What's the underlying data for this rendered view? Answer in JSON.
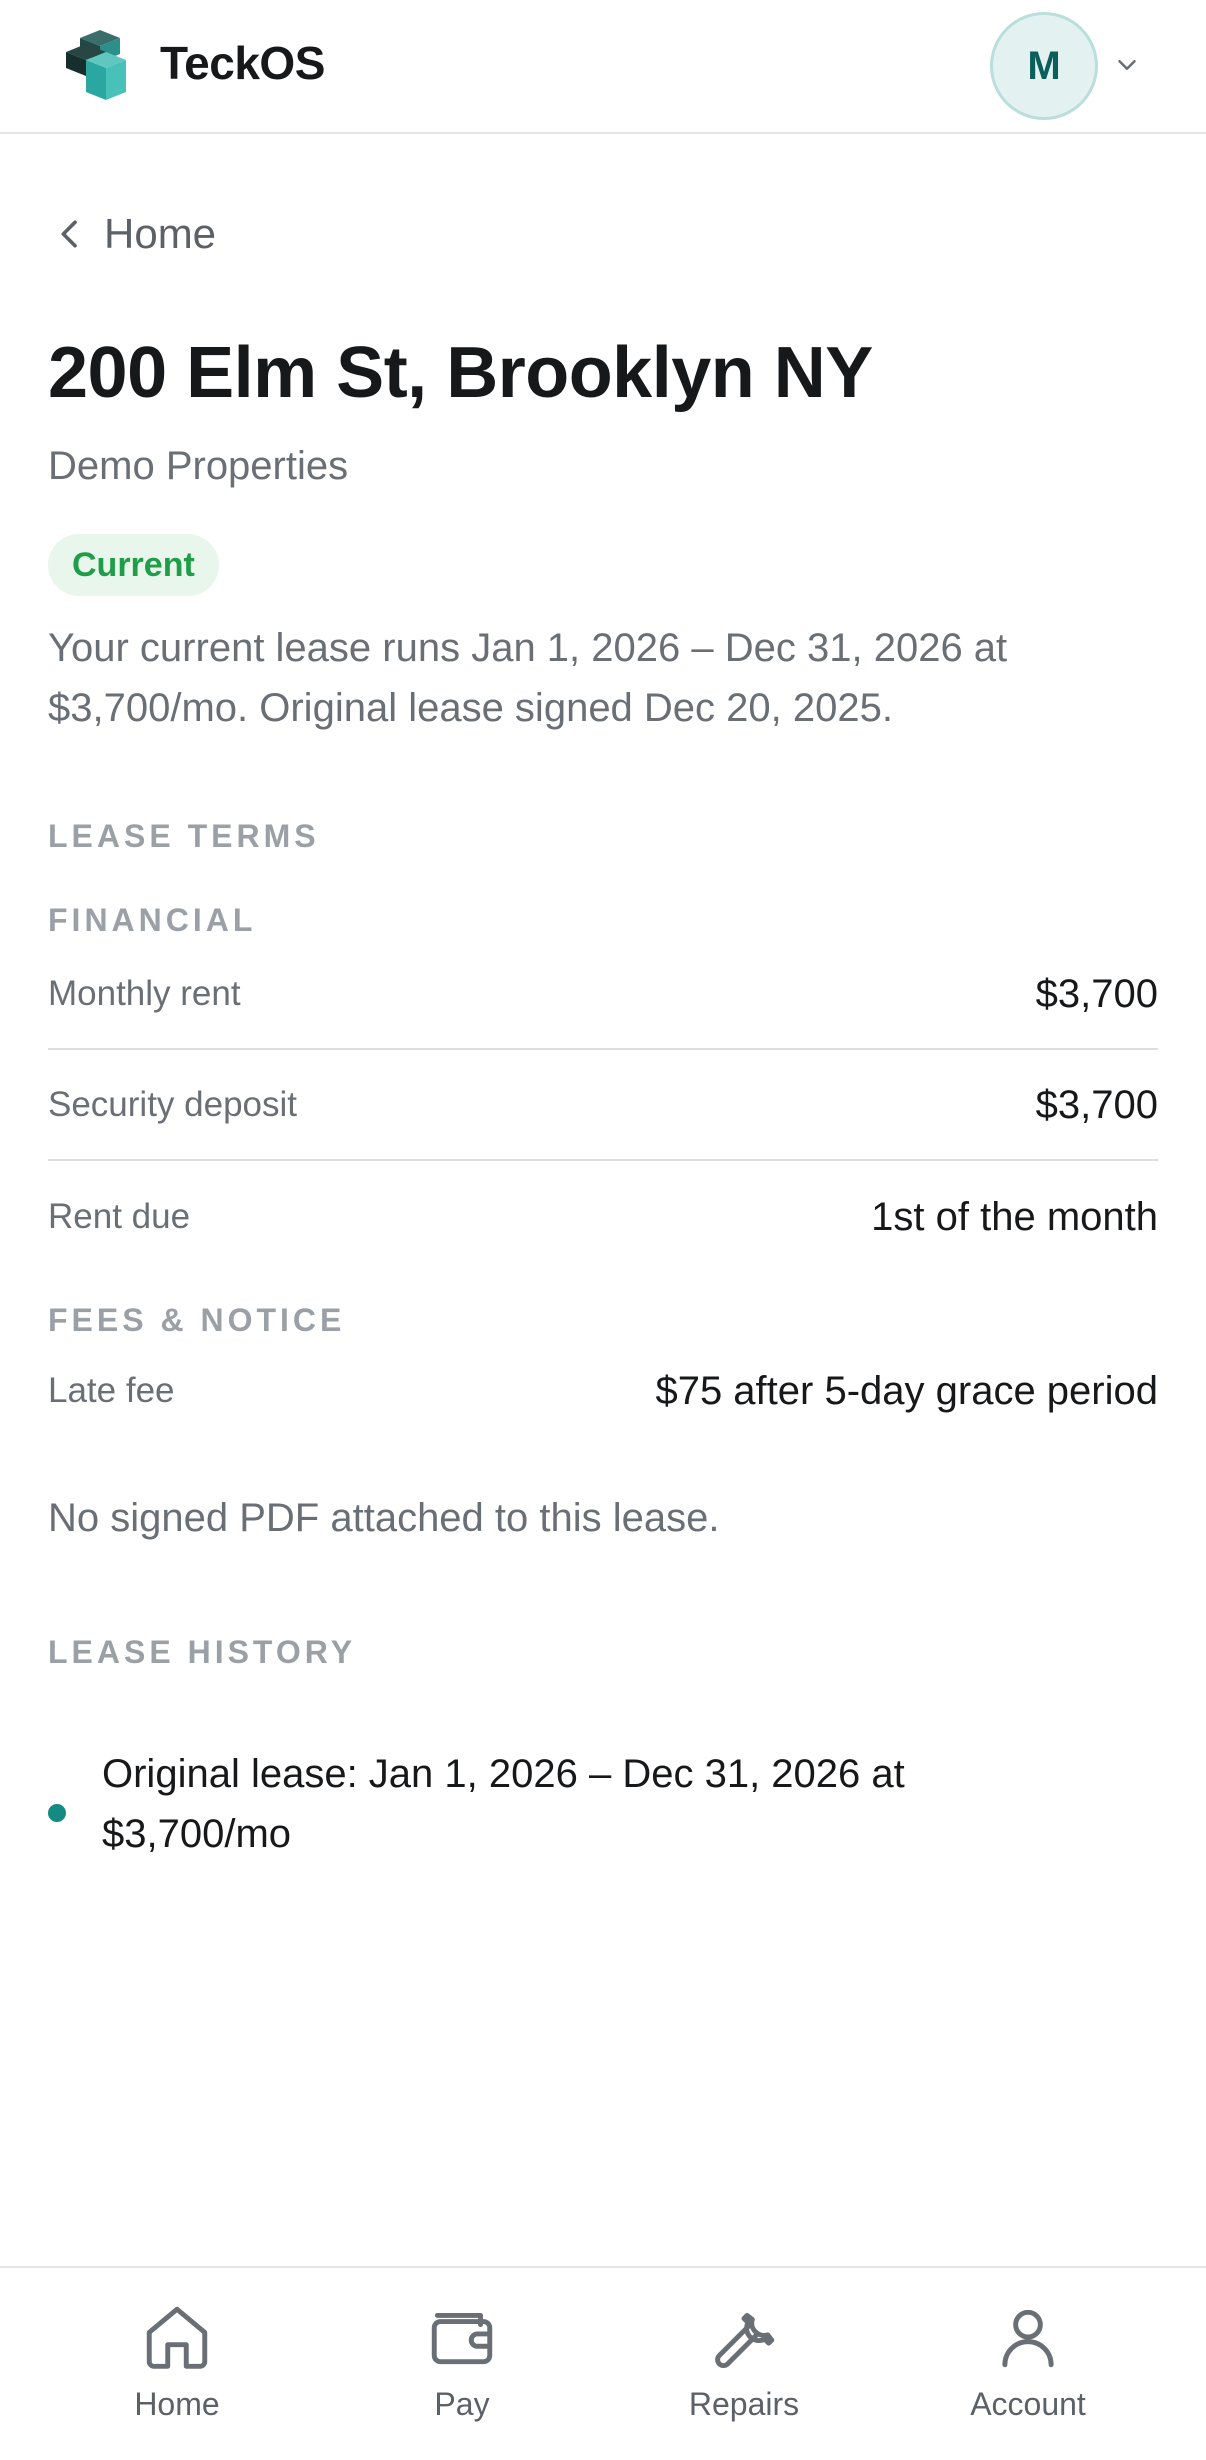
{
  "header": {
    "brand_name": "TeckOS",
    "avatar_initial": "M"
  },
  "breadcrumb": {
    "back_label": "Home"
  },
  "property": {
    "title": "200 Elm St, Brooklyn NY",
    "owner": "Demo Properties",
    "status": "Current",
    "summary": "Your current lease runs Jan 1, 2026 – Dec 31, 2026 at $3,700/mo. Original lease signed Dec 20, 2025."
  },
  "lease_terms": {
    "section_label": "LEASE TERMS",
    "financial_label": "FINANCIAL",
    "financial": [
      {
        "label": "Monthly rent",
        "value": "$3,700"
      },
      {
        "label": "Security deposit",
        "value": "$3,700"
      },
      {
        "label": "Rent due",
        "value": "1st of the month"
      }
    ],
    "fees_label": "FEES & NOTICE",
    "fees": [
      {
        "label": "Late fee",
        "value": "$75 after 5-day grace period"
      }
    ],
    "pdf_note": "No signed PDF attached to this lease."
  },
  "lease_history": {
    "section_label": "LEASE HISTORY",
    "items": [
      {
        "text": "Original lease: Jan 1, 2026 – Dec 31, 2026 at $3,700/mo"
      }
    ]
  },
  "nav": {
    "items": [
      {
        "label": "Home",
        "icon": "home-icon"
      },
      {
        "label": "Pay",
        "icon": "wallet-icon"
      },
      {
        "label": "Repairs",
        "icon": "wrench-icon"
      },
      {
        "label": "Account",
        "icon": "person-icon"
      }
    ]
  },
  "colors": {
    "accent": "#148a82",
    "status_green": "#1f9d49",
    "status_bg": "#e8f6ec",
    "avatar_bg": "#e3f2f1"
  }
}
